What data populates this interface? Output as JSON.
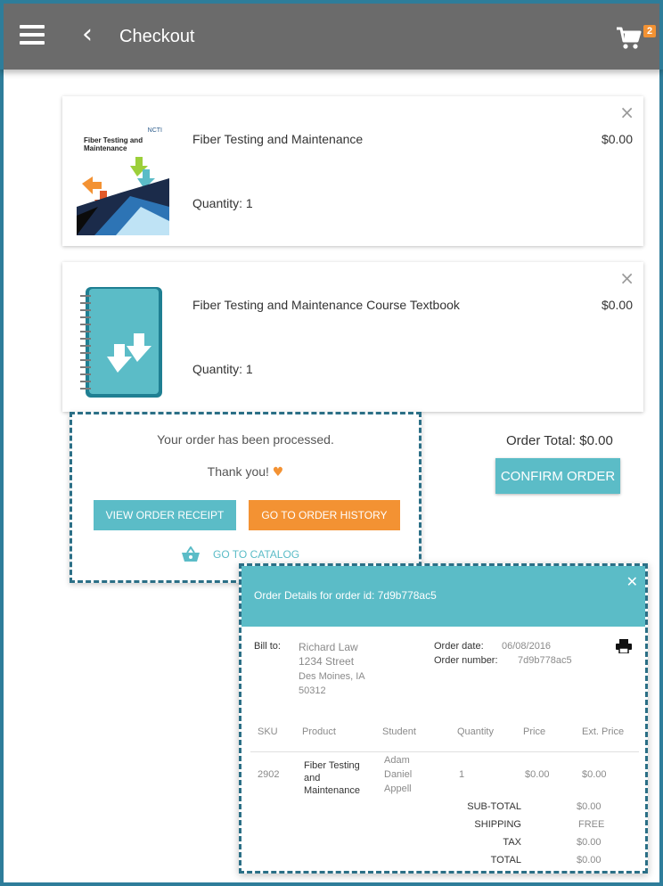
{
  "header": {
    "title": "Checkout",
    "cart_count": "2"
  },
  "colors": {
    "appbar": "#6b6b6b",
    "teal": "#5bbcc7",
    "orange": "#f39233",
    "frame": "#2e7d9a"
  },
  "cart_items": [
    {
      "name": "Fiber Testing and Maintenance",
      "quantity_label": "Quantity:",
      "quantity": "1",
      "price": "$0.00",
      "thumb_brand": "NCTI",
      "thumb_title_line1": "Fiber Testing and",
      "thumb_title_line2": "Maintenance"
    },
    {
      "name": "Fiber Testing and Maintenance Course Textbook",
      "quantity_label": "Quantity:",
      "quantity": "1",
      "price": "$0.00"
    }
  ],
  "order_total": {
    "label": "Order Total:",
    "value": "$0.00"
  },
  "confirm_label": "CONFIRM ORDER",
  "processed_popup": {
    "message": "Your order has been processed.",
    "thanks": "Thank you!",
    "view_receipt": "VIEW ORDER RECEIPT",
    "order_history": "GO TO ORDER HISTORY",
    "catalog": "GO TO CATALOG"
  },
  "order_details": {
    "title": "Order Details for order id: 7d9b778ac5",
    "bill_to_label": "Bill to:",
    "bill_to": [
      "Richard Law",
      "1234 Street",
      "Des Moines, IA",
      "50312"
    ],
    "order_date_label": "Order date:",
    "order_date": "06/08/2016",
    "order_number_label": "Order number:",
    "order_number": "7d9b778ac5",
    "columns": [
      "SKU",
      "Product",
      "Student",
      "Quantity",
      "Price",
      "Ext. Price"
    ],
    "row": {
      "sku": "2902",
      "product": [
        "Fiber Testing",
        "and",
        "Maintenance"
      ],
      "student": [
        "Adam",
        "Daniel",
        "Appell"
      ],
      "quantity": "1",
      "price": "$0.00",
      "ext_price": "$0.00"
    },
    "totals": [
      {
        "label": "SUB-TOTAL",
        "value": "$0.00"
      },
      {
        "label": "SHIPPING",
        "value": "FREE"
      },
      {
        "label": "TAX",
        "value": "$0.00"
      },
      {
        "label": "TOTAL",
        "value": "$0.00"
      }
    ]
  }
}
